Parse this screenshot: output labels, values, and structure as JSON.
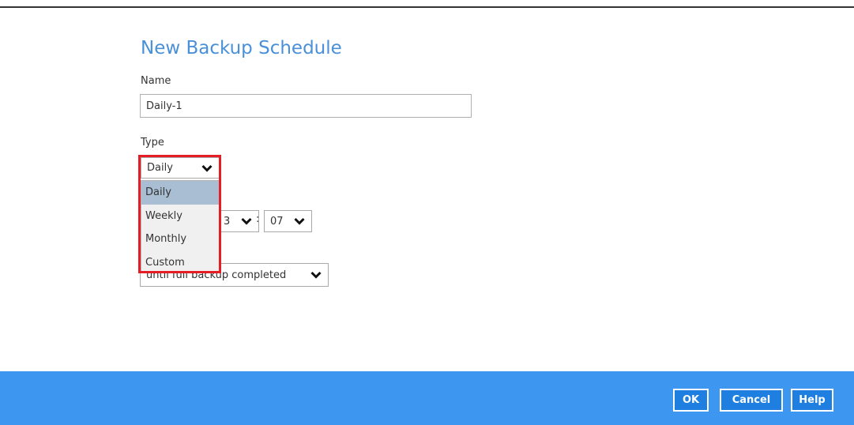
{
  "dialog": {
    "title": "New Backup Schedule",
    "name_label": "Name",
    "name_value": "Daily-1",
    "type_label": "Type",
    "type_value": "Daily",
    "type_options": [
      "Daily",
      "Weekly",
      "Monthly",
      "Custom"
    ],
    "hour_value": "3",
    "minute_value": "07",
    "time_separator": ":",
    "stop_value": "until full backup completed"
  },
  "footer": {
    "ok_label": "OK",
    "cancel_label": "Cancel",
    "help_label": "Help"
  },
  "colors": {
    "accent": "#4a90d9",
    "footer_bg": "#3d96f0",
    "highlight": "#e51e25",
    "selected_option": "#a9bed3"
  },
  "icons": {
    "dropdown": "chevron-down-icon"
  }
}
